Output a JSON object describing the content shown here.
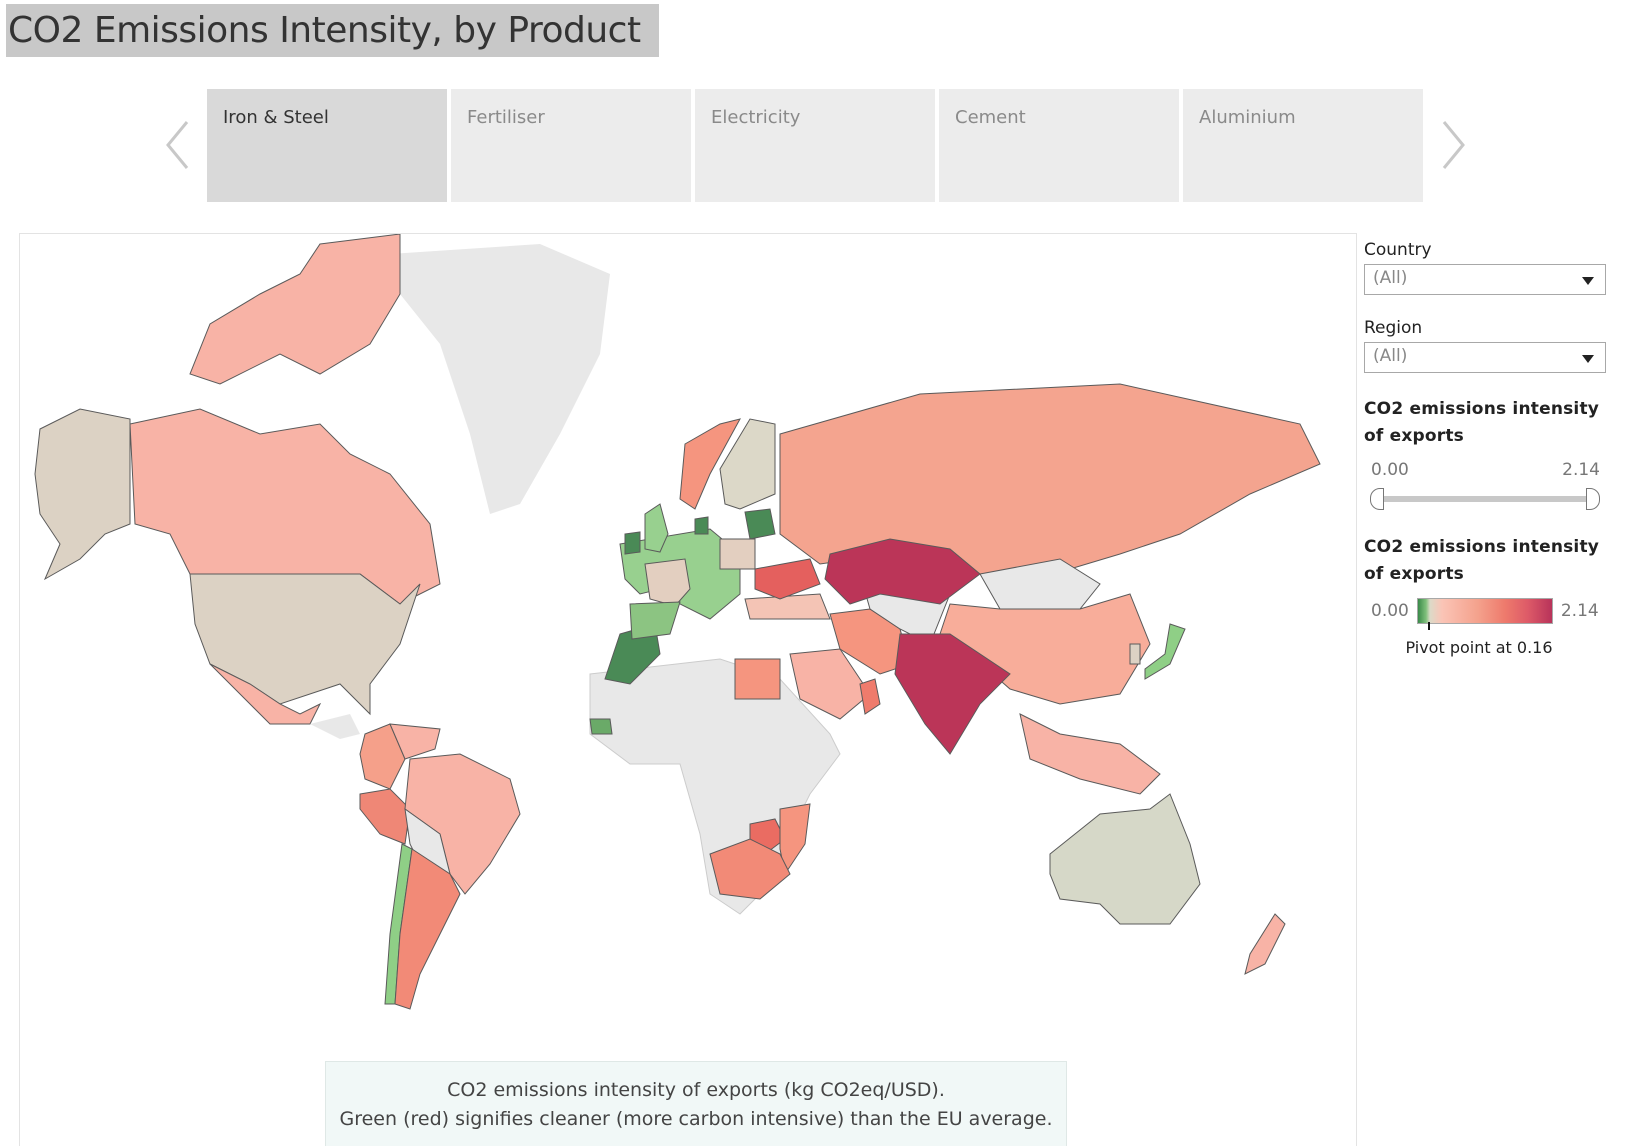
{
  "title": "CO2 Emissions Intensity, by Product",
  "navigation": {
    "prev_icon": "chevron-left-icon",
    "next_icon": "chevron-right-icon",
    "tabs": [
      {
        "label": "Iron & Steel",
        "active": true
      },
      {
        "label": "Fertiliser",
        "active": false
      },
      {
        "label": "Electricity",
        "active": false
      },
      {
        "label": "Cement",
        "active": false
      },
      {
        "label": "Aluminium",
        "active": false
      }
    ]
  },
  "filters": {
    "country": {
      "label": "Country",
      "value": "(All)"
    },
    "region": {
      "label": "Region",
      "value": "(All)"
    }
  },
  "range_filter": {
    "title_line1": "CO2 emissions intensity",
    "title_line2": "of exports",
    "min_label": "0.00",
    "max_label": "2.14",
    "min": 0.0,
    "max": 2.14
  },
  "color_legend": {
    "title_line1": "CO2 emissions intensity",
    "title_line2": "of exports",
    "min_label": "0.00",
    "max_label": "2.14",
    "pivot_text": "Pivot point at 0.16",
    "pivot_value": 0.16,
    "colors": {
      "low": "#3a8a4a",
      "pivot": "#dcdac8",
      "high": "#b8335a",
      "nodata": "#e8e8e8"
    }
  },
  "caption": {
    "line1": "CO2 emissions intensity of exports (kg CO2eq/USD).",
    "line2": "Green (red) signifies cleaner (more carbon intensive) than the EU average."
  },
  "map": {
    "regions": [
      {
        "name": "Canada",
        "tone": "light-red"
      },
      {
        "name": "United States",
        "tone": "neutral"
      },
      {
        "name": "Alaska",
        "tone": "neutral"
      },
      {
        "name": "Mexico",
        "tone": "light-red"
      },
      {
        "name": "Greenland",
        "tone": "no-data"
      },
      {
        "name": "Colombia",
        "tone": "red"
      },
      {
        "name": "Venezuela",
        "tone": "light-red"
      },
      {
        "name": "Peru",
        "tone": "red"
      },
      {
        "name": "Brazil",
        "tone": "light-red"
      },
      {
        "name": "Argentina",
        "tone": "red"
      },
      {
        "name": "Chile",
        "tone": "light-green"
      },
      {
        "name": "Africa",
        "tone": "no-data"
      },
      {
        "name": "Morocco",
        "tone": "dark-green"
      },
      {
        "name": "Senegal",
        "tone": "green"
      },
      {
        "name": "Egypt",
        "tone": "red"
      },
      {
        "name": "South Africa",
        "tone": "red"
      },
      {
        "name": "Zimbabwe",
        "tone": "strong-red"
      },
      {
        "name": "Mozambique",
        "tone": "red"
      },
      {
        "name": "Western Europe",
        "tone": "light-green"
      },
      {
        "name": "France",
        "tone": "neutral"
      },
      {
        "name": "Ireland",
        "tone": "dark-green"
      },
      {
        "name": "Norway",
        "tone": "red"
      },
      {
        "name": "Sweden",
        "tone": "neutral"
      },
      {
        "name": "Ukraine",
        "tone": "strong-red"
      },
      {
        "name": "Turkey",
        "tone": "light-red"
      },
      {
        "name": "Russia",
        "tone": "light-red"
      },
      {
        "name": "Kazakhstan",
        "tone": "dark-red"
      },
      {
        "name": "Mongolia",
        "tone": "no-data"
      },
      {
        "name": "China",
        "tone": "light-red"
      },
      {
        "name": "India",
        "tone": "dark-red"
      },
      {
        "name": "Iran",
        "tone": "red"
      },
      {
        "name": "Saudi Arabia",
        "tone": "light-red"
      },
      {
        "name": "Japan",
        "tone": "light-green"
      },
      {
        "name": "South Korea",
        "tone": "neutral"
      },
      {
        "name": "Southeast Asia",
        "tone": "light-red"
      },
      {
        "name": "Australia",
        "tone": "neutral"
      },
      {
        "name": "New Zealand",
        "tone": "light-red"
      }
    ]
  }
}
